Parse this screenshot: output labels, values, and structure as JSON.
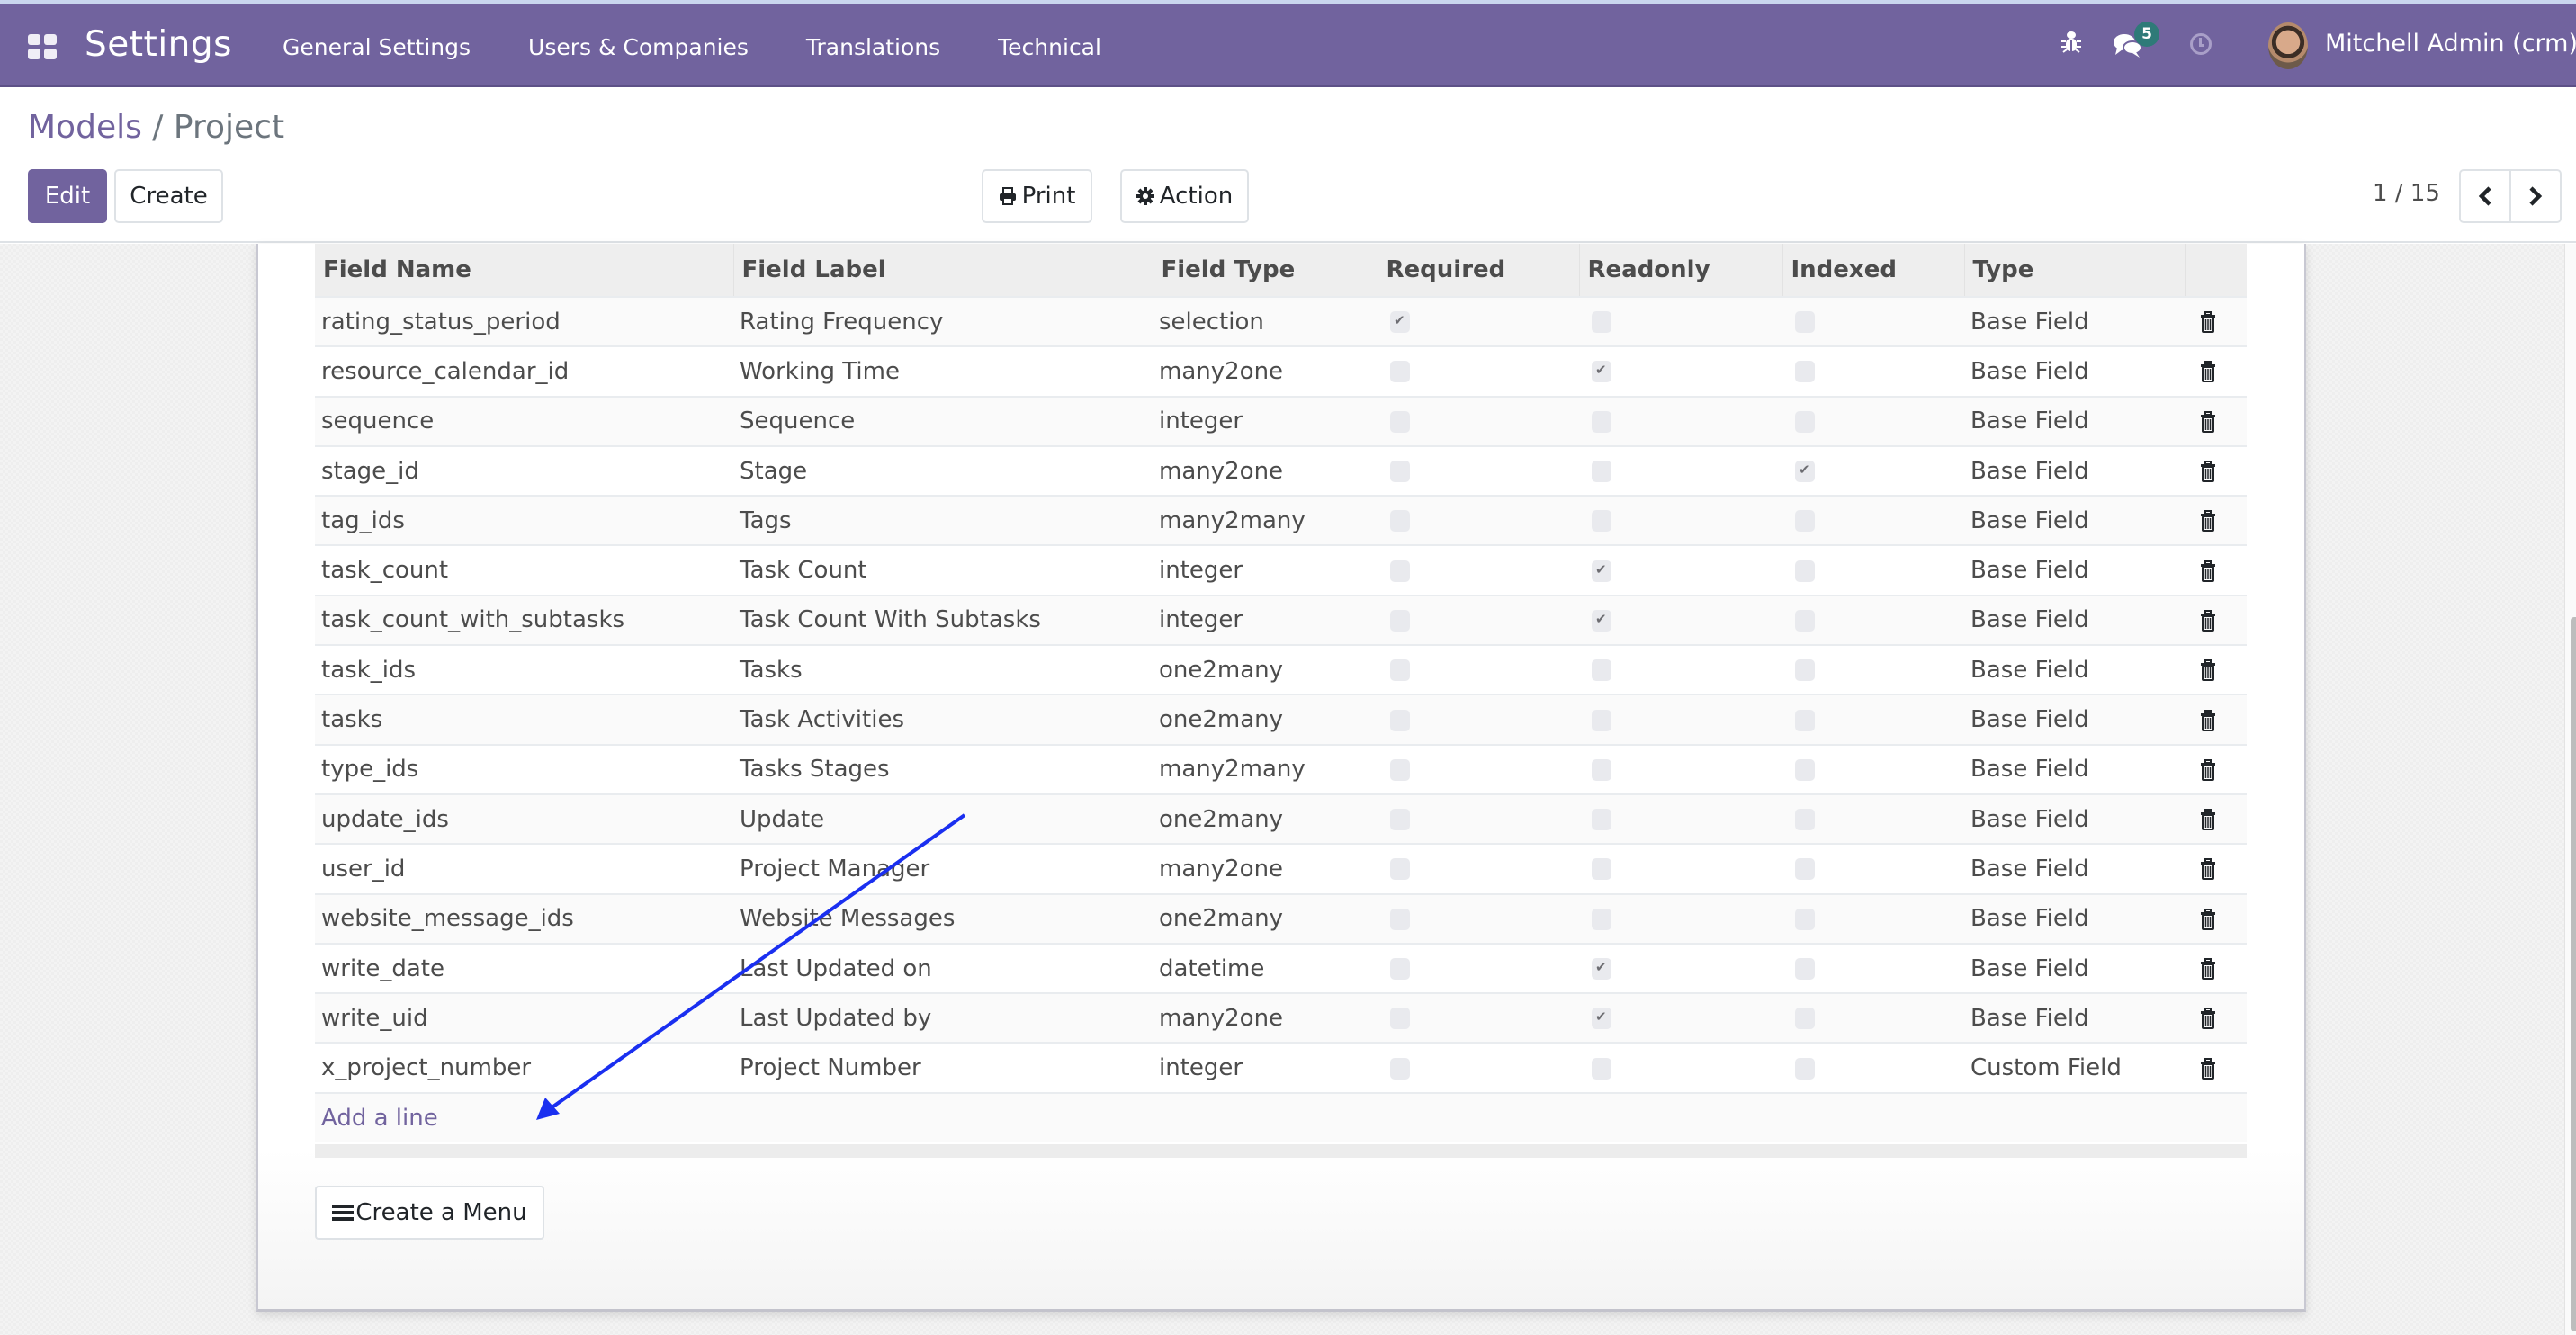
{
  "navbar": {
    "app_title": "Settings",
    "menu": [
      "General Settings",
      "Users & Companies",
      "Translations",
      "Technical"
    ],
    "chat_badge_count": "5",
    "user_name": "Mitchell Admin (crm)",
    "icons": {
      "apps": "apps-grid-icon",
      "debug": "bug-icon",
      "messages": "chat-icon",
      "activities": "clock-icon"
    },
    "color": "#71639e"
  },
  "breadcrumb": {
    "parent": "Models",
    "separator": "/",
    "current": "Project"
  },
  "toolbar": {
    "edit_label": "Edit",
    "create_label": "Create",
    "print_label": "Print",
    "action_label": "Action",
    "pager_value": "1 / 15",
    "prev_icon": "chevron-left-icon",
    "next_icon": "chevron-right-icon"
  },
  "fields_table": {
    "columns": [
      "Field Name",
      "Field Label",
      "Field Type",
      "Required",
      "Readonly",
      "Indexed",
      "Type",
      ""
    ],
    "rows": [
      {
        "name": "rating_status_period",
        "label": "Rating Frequency",
        "type": "selection",
        "required": true,
        "readonly": false,
        "indexed": false,
        "kind": "Base Field"
      },
      {
        "name": "resource_calendar_id",
        "label": "Working Time",
        "type": "many2one",
        "required": false,
        "readonly": true,
        "indexed": false,
        "kind": "Base Field"
      },
      {
        "name": "sequence",
        "label": "Sequence",
        "type": "integer",
        "required": false,
        "readonly": false,
        "indexed": false,
        "kind": "Base Field"
      },
      {
        "name": "stage_id",
        "label": "Stage",
        "type": "many2one",
        "required": false,
        "readonly": false,
        "indexed": true,
        "kind": "Base Field"
      },
      {
        "name": "tag_ids",
        "label": "Tags",
        "type": "many2many",
        "required": false,
        "readonly": false,
        "indexed": false,
        "kind": "Base Field"
      },
      {
        "name": "task_count",
        "label": "Task Count",
        "type": "integer",
        "required": false,
        "readonly": true,
        "indexed": false,
        "kind": "Base Field"
      },
      {
        "name": "task_count_with_subtasks",
        "label": "Task Count With Subtasks",
        "type": "integer",
        "required": false,
        "readonly": true,
        "indexed": false,
        "kind": "Base Field"
      },
      {
        "name": "task_ids",
        "label": "Tasks",
        "type": "one2many",
        "required": false,
        "readonly": false,
        "indexed": false,
        "kind": "Base Field"
      },
      {
        "name": "tasks",
        "label": "Task Activities",
        "type": "one2many",
        "required": false,
        "readonly": false,
        "indexed": false,
        "kind": "Base Field"
      },
      {
        "name": "type_ids",
        "label": "Tasks Stages",
        "type": "many2many",
        "required": false,
        "readonly": false,
        "indexed": false,
        "kind": "Base Field"
      },
      {
        "name": "update_ids",
        "label": "Update",
        "type": "one2many",
        "required": false,
        "readonly": false,
        "indexed": false,
        "kind": "Base Field"
      },
      {
        "name": "user_id",
        "label": "Project Manager",
        "type": "many2one",
        "required": false,
        "readonly": false,
        "indexed": false,
        "kind": "Base Field"
      },
      {
        "name": "website_message_ids",
        "label": "Website Messages",
        "type": "one2many",
        "required": false,
        "readonly": false,
        "indexed": false,
        "kind": "Base Field"
      },
      {
        "name": "write_date",
        "label": "Last Updated on",
        "type": "datetime",
        "required": false,
        "readonly": true,
        "indexed": false,
        "kind": "Base Field"
      },
      {
        "name": "write_uid",
        "label": "Last Updated by",
        "type": "many2one",
        "required": false,
        "readonly": true,
        "indexed": false,
        "kind": "Base Field"
      },
      {
        "name": "x_project_number",
        "label": "Project Number",
        "type": "integer",
        "required": false,
        "readonly": false,
        "indexed": false,
        "kind": "Custom Field"
      }
    ],
    "add_line_label": "Add a line",
    "row_delete_icon": "trash-icon"
  },
  "create_menu": {
    "label": "Create a Menu",
    "icon": "bars-icon"
  },
  "annotation": {
    "type": "arrow",
    "points_to": "Add a line",
    "color": "#1a2ff0"
  }
}
